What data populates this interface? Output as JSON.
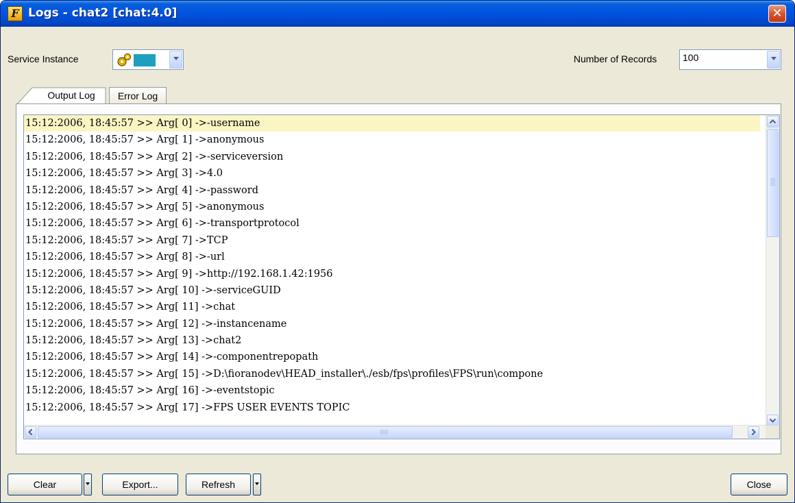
{
  "window": {
    "title": "Logs - chat2 [chat:4.0]",
    "app_icon_letter": "F"
  },
  "toolbar": {
    "service_instance_label": "Service Instance",
    "records_label": "Number of Records",
    "records_value": "100"
  },
  "tabs": [
    {
      "label": "Output Log",
      "selected": true
    },
    {
      "label": "Error Log",
      "selected": false
    }
  ],
  "log": {
    "lines": [
      "15:12:2006, 18:45:57 >> Arg[ 0] ->-username",
      "15:12:2006, 18:45:57 >> Arg[ 1] ->anonymous",
      "15:12:2006, 18:45:57 >> Arg[ 2] ->-serviceversion",
      "15:12:2006, 18:45:57 >> Arg[ 3] ->4.0",
      "15:12:2006, 18:45:57 >> Arg[ 4] ->-password",
      "15:12:2006, 18:45:57 >> Arg[ 5] ->anonymous",
      "15:12:2006, 18:45:57 >> Arg[ 6] ->-transportprotocol",
      "15:12:2006, 18:45:57 >> Arg[ 7] ->TCP",
      "15:12:2006, 18:45:57 >> Arg[ 8] ->-url",
      "15:12:2006, 18:45:57 >> Arg[ 9] ->http://192.168.1.42:1956",
      "15:12:2006, 18:45:57 >> Arg[ 10] ->-serviceGUID",
      "15:12:2006, 18:45:57 >> Arg[ 11] ->chat",
      "15:12:2006, 18:45:57 >> Arg[ 12] ->-instancename",
      "15:12:2006, 18:45:57 >> Arg[ 13] ->chat2",
      "15:12:2006, 18:45:57 >> Arg[ 14] ->-componentrepopath",
      "15:12:2006, 18:45:57 >> Arg[ 15] ->D:\\fioranodev\\HEAD_installer\\./esb/fps\\profiles\\FPS\\run\\compone",
      "15:12:2006, 18:45:57 >> Arg[ 16] ->-eventstopic",
      "15:12:2006, 18:45:57 >> Arg[ 17] ->FPS USER EVENTS TOPIC"
    ],
    "highlight_color": "#fbf5c3"
  },
  "buttons": {
    "clear": "Clear",
    "export": "Export...",
    "refresh": "Refresh",
    "close": "Close"
  },
  "icons": {
    "app": "fiorano-app-icon",
    "close": "close-icon",
    "service": "gear-icon"
  },
  "colors": {
    "title_bar": "#0054e3",
    "window_bg": "#ece9d8",
    "close_button": "#d8542c"
  }
}
